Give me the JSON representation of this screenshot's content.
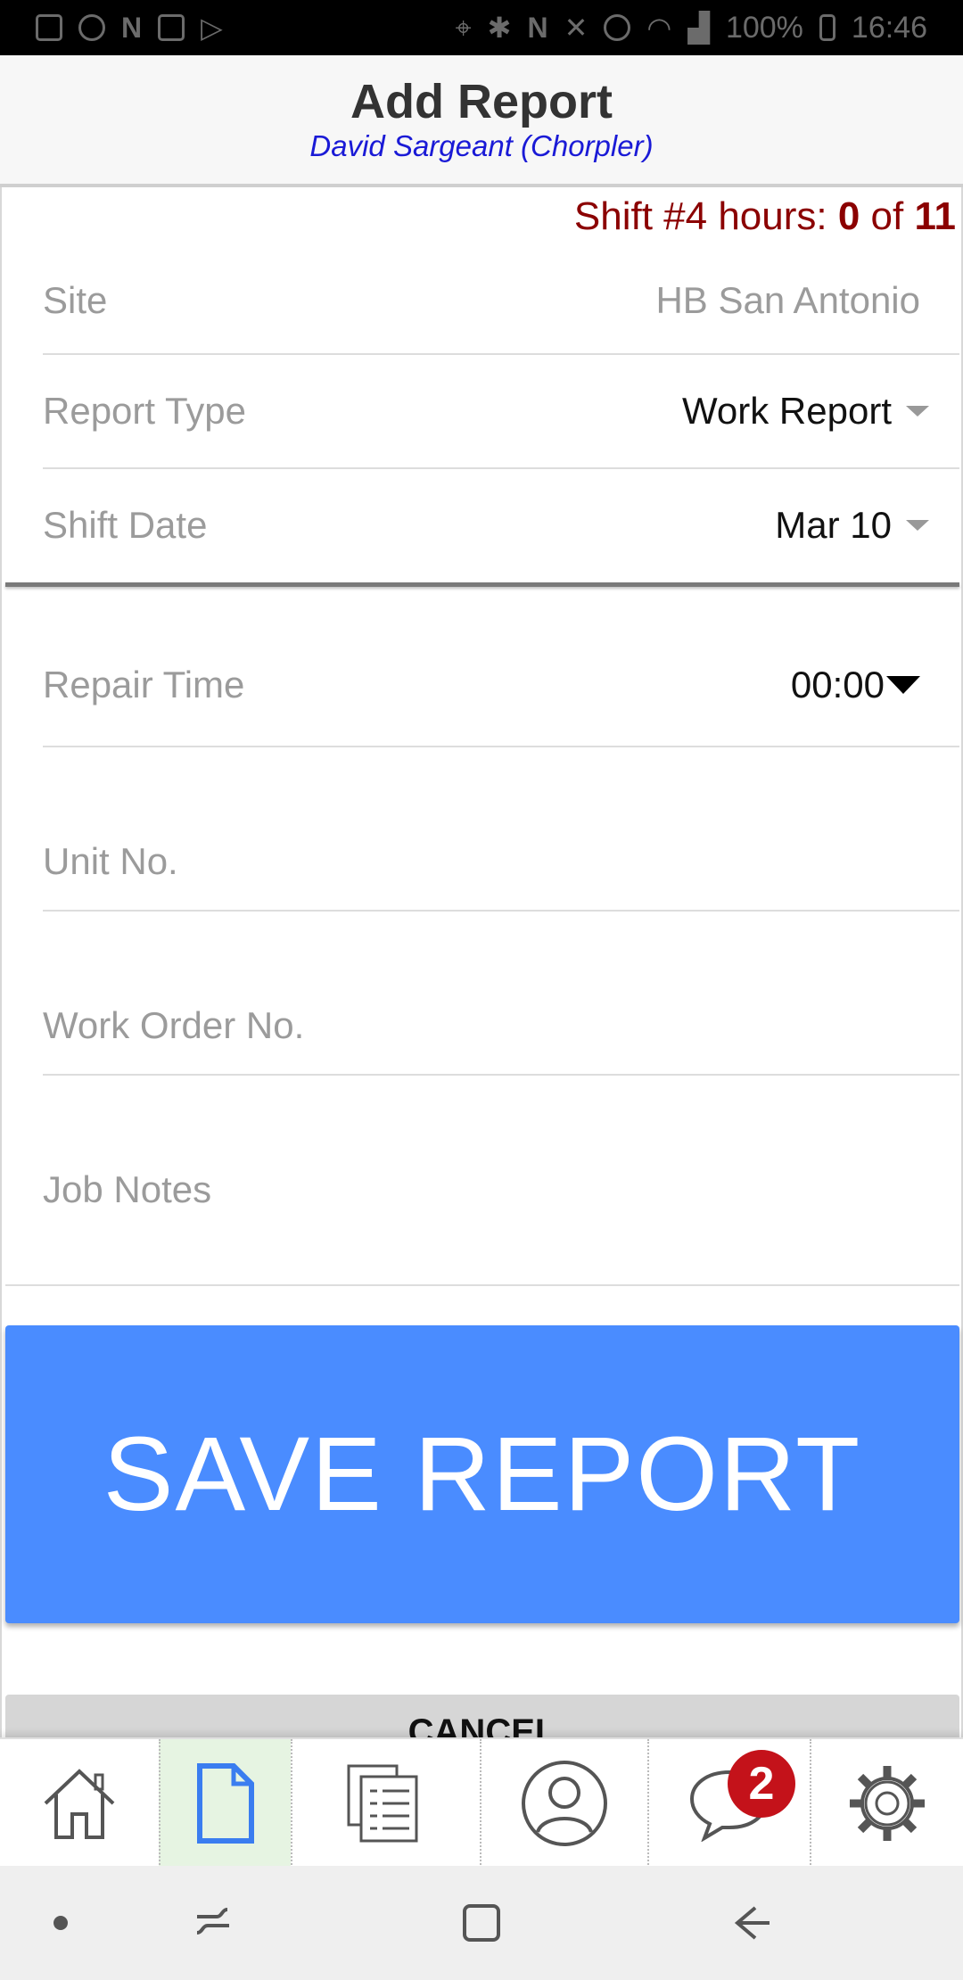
{
  "status_bar": {
    "battery": "100%",
    "time": "16:46",
    "left_icons": [
      "mail-icon",
      "account-icon",
      "n-icon",
      "sim-icon",
      "play-store-icon"
    ],
    "right_icons": [
      "location-icon",
      "bluetooth-icon",
      "nfc-icon",
      "mute-icon",
      "alarm-icon",
      "wifi-icon",
      "signal-icon",
      "battery-charging-icon"
    ]
  },
  "header": {
    "title": "Add Report",
    "subtitle": "David Sargeant (Chorpler)"
  },
  "shift": {
    "prefix": "Shift #4 hours: ",
    "current": "0",
    "of_text": " of ",
    "total": "11"
  },
  "form": {
    "site": {
      "label": "Site",
      "value": "HB San Antonio"
    },
    "report_type": {
      "label": "Report Type",
      "value": "Work Report"
    },
    "shift_date": {
      "label": "Shift Date",
      "value": "Mar 10"
    },
    "repair_time": {
      "label": "Repair Time",
      "value": "00:00"
    },
    "unit_no": {
      "placeholder": "Unit No.",
      "value": ""
    },
    "work_order_no": {
      "placeholder": "Work Order No.",
      "value": ""
    },
    "job_notes": {
      "placeholder": "Job Notes",
      "value": ""
    }
  },
  "buttons": {
    "save": "SAVE REPORT",
    "cancel": "CANCEL"
  },
  "tabs": [
    {
      "icon": "home-icon",
      "active": false
    },
    {
      "icon": "document-icon",
      "active": true
    },
    {
      "icon": "reports-list-icon",
      "active": false
    },
    {
      "icon": "profile-icon",
      "active": false
    },
    {
      "icon": "chat-icon",
      "active": false,
      "badge": "2"
    },
    {
      "icon": "settings-gear-icon",
      "active": false
    }
  ],
  "colors": {
    "accent": "#4a8cff",
    "shift_text": "#8b0000",
    "subtitle": "#1a1ad6",
    "badge": "#c4121a",
    "active_tab": "#e6f4e2"
  },
  "nav_bar": [
    "dot-icon",
    "recent-apps-icon",
    "home-square-icon",
    "back-arrow-icon"
  ]
}
